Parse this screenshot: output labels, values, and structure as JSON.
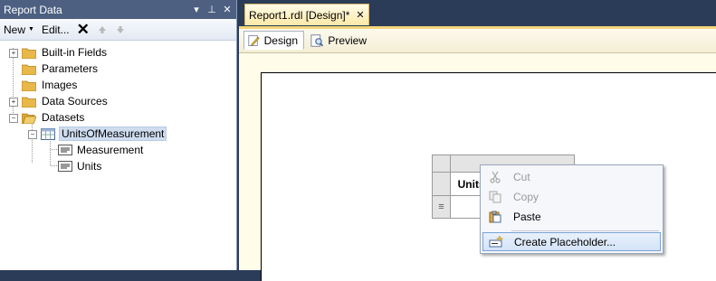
{
  "report_data_panel": {
    "title": "Report Data",
    "title_buttons": [
      "▾",
      "⊥",
      "✕"
    ],
    "toolbar": {
      "new_label": "New",
      "edit_label": "Edit..."
    },
    "tree": {
      "built_in_fields": "Built-in Fields",
      "parameters": "Parameters",
      "images": "Images",
      "data_sources": "Data Sources",
      "datasets": "Datasets",
      "dataset_name": "UnitsOfMeasurement",
      "field_1": "Measurement",
      "field_2": "Units"
    }
  },
  "document": {
    "tab_title": "Report1.rdl [Design]*",
    "tab_close": "✕",
    "view_tabs": {
      "design": "Design",
      "preview": "Preview"
    }
  },
  "tablix": {
    "header_text": "UnitsOfMeasurement",
    "row_handle": "≡"
  },
  "context_menu": {
    "cut": "Cut",
    "copy": "Copy",
    "paste": "Paste",
    "create_placeholder": "Create Placeholder..."
  },
  "colors": {
    "panel_title_bg": "#4d6082",
    "app_bg": "#2b3c59",
    "doc_tab_bg": "#ffe9a8",
    "menu_highlight": "#d3e3f8"
  }
}
